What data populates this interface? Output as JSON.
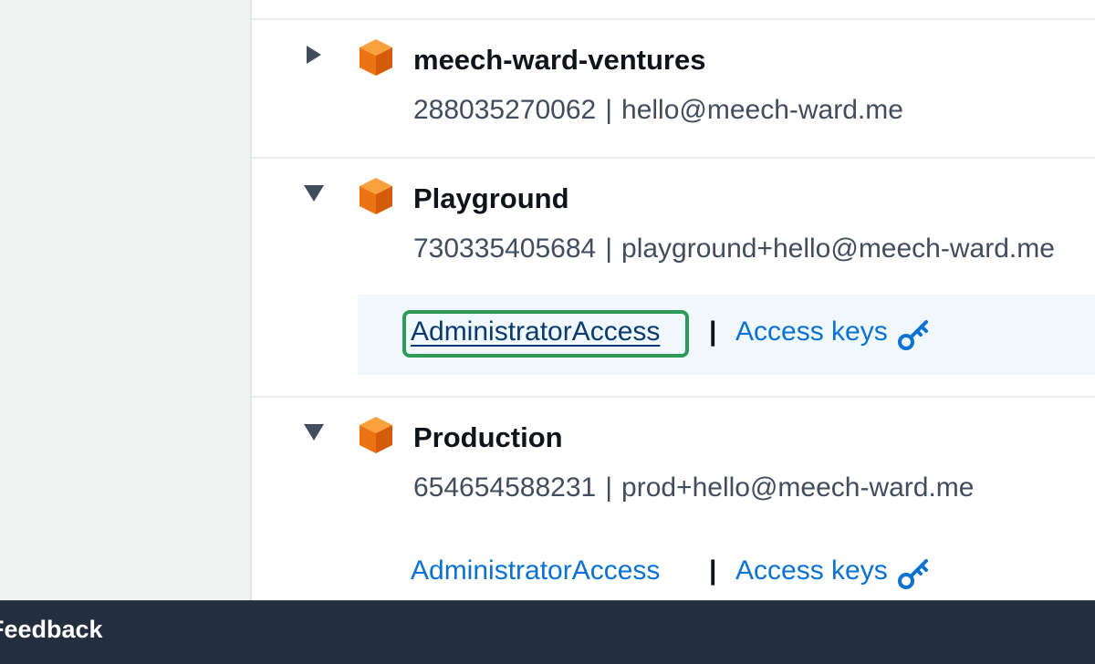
{
  "accounts": [
    {
      "name": "meech-ward-ventures",
      "id": "288035270062",
      "email": "hello@meech-ward.me",
      "expanded": false
    },
    {
      "name": "Playground",
      "id": "730335405684",
      "email": "playground+hello@meech-ward.me",
      "expanded": true,
      "role_label": "AdministratorAccess",
      "keys_label": "Access keys"
    },
    {
      "name": "Production",
      "id": "654654588231",
      "email": "prod+hello@meech-ward.me",
      "expanded": true,
      "role_label": "AdministratorAccess",
      "keys_label": "Access keys"
    }
  ],
  "separator": "|",
  "footer": {
    "feedback_label": "Feedback"
  },
  "colors": {
    "cube_orange": "#ed7211",
    "link_blue": "#0972d3",
    "focus_green": "#2e9c58",
    "footer_bg": "#232f3e"
  },
  "icons": {
    "expand": "caret-right-icon",
    "collapse": "caret-down-icon",
    "account": "cube-icon",
    "keys": "key-icon"
  }
}
